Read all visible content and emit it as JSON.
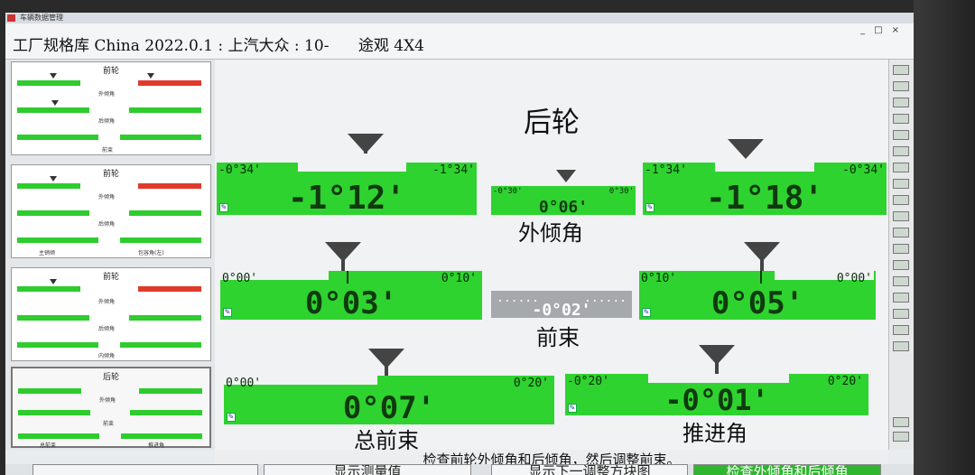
{
  "app_bar": {
    "text": "车辆数据管理"
  },
  "title": "工厂规格库 China 2022.0.1 : 上汽大众 : 10-      途观 4X4",
  "window_controls": [
    "_",
    "□",
    "×"
  ],
  "screen_title": "后轮",
  "thumbnails": [
    {
      "title": "前轮",
      "labels": [
        "外倾角",
        "后倾角",
        "前束"
      ]
    },
    {
      "title": "前轮",
      "labels": [
        "外倾角",
        "后倾角",
        "主销倾",
        "包容角(左)"
      ]
    },
    {
      "title": "前轮",
      "labels": [
        "外倾角",
        "后倾角",
        "内倾角"
      ]
    },
    {
      "title": "后轮",
      "labels": [
        "外倾角",
        "前束",
        "总前束",
        "推进角"
      ]
    }
  ],
  "sections": {
    "camber": {
      "label": "外倾角",
      "left": {
        "min": "-0°34'",
        "max": "-1°34'",
        "value": "-1°12'"
      },
      "center": {
        "min": "-0°30'",
        "max": "0°30'",
        "value": "0°06'"
      },
      "right": {
        "min": "-1°34'",
        "max": "-0°34'",
        "value": "-1°18'"
      }
    },
    "toe": {
      "label": "前束",
      "left": {
        "min": "0°00'",
        "max": "0°10'",
        "value": "0°03'"
      },
      "center": {
        "min": "......",
        "max": "......",
        "value": "-0°02'"
      },
      "right": {
        "min": "0°10'",
        "max": "0°00'",
        "value": "0°05'"
      }
    },
    "total_toe": {
      "label": "总前束",
      "gauge": {
        "min": "0°00'",
        "max": "0°20'",
        "value": "0°07'"
      }
    },
    "thrust": {
      "label": "推进角",
      "gauge": {
        "min": "-0°20'",
        "max": "0°20'",
        "value": "-0°01'"
      }
    }
  },
  "status_text": "检查前轮外倾角和后倾角，然后调整前束。",
  "buttons": {
    "show_measure": "显示测量值",
    "next_block": "显示下一调整方块图",
    "check_camber_caster": "检查外倾角和后倾角"
  },
  "colors": {
    "in_spec": "#2fd32f",
    "out_spec": "#e03a2a",
    "neutral": "#a6a9ac"
  }
}
